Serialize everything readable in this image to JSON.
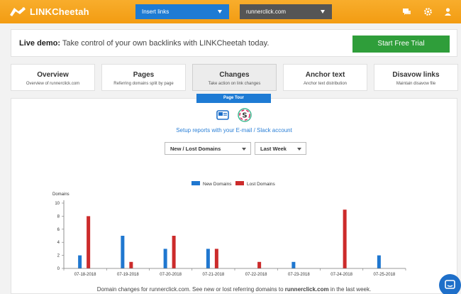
{
  "brand": {
    "name": "LINKCheetah",
    "color": "#f39c12"
  },
  "top_controls": {
    "links_select": "Insert links",
    "domain_select": "runnerclick.com"
  },
  "banner": {
    "lead": "Live demo:",
    "text": " Take control of your own backlinks with LINKCheetah today.",
    "cta": "Start Free Trial"
  },
  "tabs": [
    {
      "title": "Overview",
      "sub": "Overview of runnerclick.com"
    },
    {
      "title": "Pages",
      "sub": "Referring domains split by page"
    },
    {
      "title": "Changes",
      "sub": "Take action on link changes"
    },
    {
      "title": "Anchor text",
      "sub": "Anchor text distribution"
    },
    {
      "title": "Disavow links",
      "sub": "Maintain disavow file"
    }
  ],
  "page_tour": "Page Tour",
  "setup_text": "Setup reports with your E-mail / Slack account",
  "filters": {
    "metric": "New / Lost Domains",
    "period": "Last Week"
  },
  "footer": {
    "prefix": "Domain changes for runnerclick.com. See new or lost referring domains to ",
    "domain": "runnerclick.com",
    "suffix": " in the last week."
  },
  "chart_data": {
    "type": "bar",
    "ylabel": "Domains",
    "ylim": [
      0,
      10
    ],
    "yticks": [
      0,
      2,
      4,
      6,
      8,
      10
    ],
    "legend_position": "top-center",
    "categories": [
      "07-18-2018",
      "07-19-2018",
      "07-20-2018",
      "07-21-2018",
      "07-22-2018",
      "07-23-2018",
      "07-24-2018",
      "07-25-2018"
    ],
    "series": [
      {
        "name": "New Domains",
        "color": "#1f77d0",
        "values": [
          2,
          5,
          3,
          3,
          0,
          1,
          0,
          2
        ]
      },
      {
        "name": "Lost Domains",
        "color": "#cc2b2b",
        "values": [
          8,
          1,
          5,
          3,
          1,
          0,
          9,
          0
        ]
      }
    ]
  }
}
